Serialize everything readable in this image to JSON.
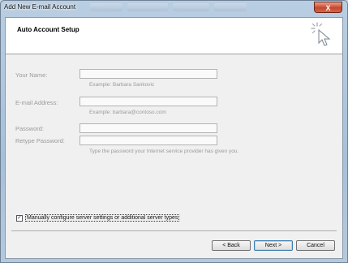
{
  "window": {
    "title": "Add New E-mail Account",
    "close_glyph": "X"
  },
  "header": {
    "heading": "Auto Account Setup",
    "icon": "magic-wand-icon"
  },
  "form": {
    "your_name": {
      "label": "Your Name:",
      "value": "",
      "hint": "Example: Barbara Sankovic"
    },
    "email": {
      "label": "E-mail Address:",
      "value": "",
      "hint": "Example: barbara@contoso.com"
    },
    "password": {
      "label": "Password:",
      "value": ""
    },
    "retype_password": {
      "label": "Retype Password:",
      "value": "",
      "hint": "Type the password your Internet service provider has given you."
    }
  },
  "manual_config": {
    "label": "Manually configure server settings or additional server types",
    "checked": true
  },
  "buttons": {
    "back": "< Back",
    "next": "Next >",
    "cancel": "Cancel"
  },
  "colors": {
    "titlebar": "#a7c0d8",
    "dialog_bg": "#f0f0f0",
    "disabled_text": "#9a9a9a",
    "default_button_border": "#3c7fb1"
  }
}
